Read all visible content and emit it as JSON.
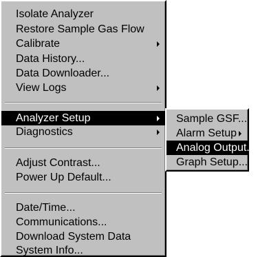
{
  "main_menu": {
    "group1": [
      {
        "label": "Isolate Analyzer",
        "has_submenu": false
      },
      {
        "label": "Restore Sample Gas Flow",
        "has_submenu": false
      },
      {
        "label": "Calibrate",
        "has_submenu": true
      },
      {
        "label": "Data History...",
        "has_submenu": false
      },
      {
        "label": "Data Downloader...",
        "has_submenu": false
      },
      {
        "label": "View Logs",
        "has_submenu": true
      }
    ],
    "group2": [
      {
        "label": "Analyzer Setup",
        "has_submenu": true,
        "selected": true
      },
      {
        "label": "Diagnostics",
        "has_submenu": true
      }
    ],
    "group3": [
      {
        "label": "Adjust Contrast...",
        "has_submenu": false
      },
      {
        "label": "Power Up Default...",
        "has_submenu": false
      }
    ],
    "group4": [
      {
        "label": "Date/Time...",
        "has_submenu": false
      },
      {
        "label": "Communications...",
        "has_submenu": false
      },
      {
        "label": "Download System Data",
        "has_submenu": false
      },
      {
        "label": "System Info...",
        "has_submenu": false
      }
    ]
  },
  "analyzer_setup_submenu": {
    "items": [
      {
        "label": "Sample GSF...",
        "has_submenu": false
      },
      {
        "label": "Alarm Setup",
        "has_submenu": true
      },
      {
        "label": "Analog Output...",
        "has_submenu": false,
        "selected": true
      },
      {
        "label": "Graph Setup...",
        "has_submenu": false
      }
    ]
  },
  "colors": {
    "menu_face": "#c0c0c0",
    "highlight": "#000000",
    "highlight_text": "#ffffff"
  }
}
